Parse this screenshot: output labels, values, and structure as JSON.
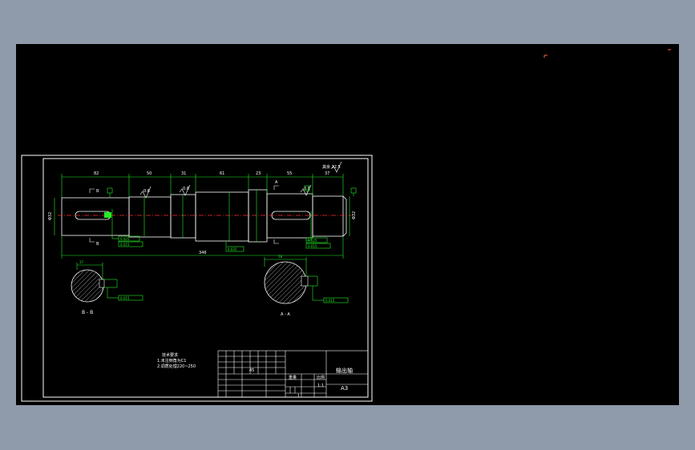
{
  "drawing": {
    "colors": {
      "background": "#000000",
      "outline": "#ffffff",
      "dimension": "#22ee22",
      "centerline": "#ff2a2a",
      "hatch": "#cfcfcf",
      "marker": "#ff6a3a"
    },
    "dims": {
      "top": [
        "82",
        "50",
        "31",
        "61",
        "23",
        "55",
        "37"
      ],
      "total": "346",
      "dia_left": "Φ32",
      "dia_right": "Φ32"
    },
    "tolerances": {
      "t1": "0.025",
      "t2": "0.015",
      "t3": "0.025",
      "t4": "0.015",
      "t5": "0.025",
      "t6": "0.015"
    },
    "roughness": {
      "r1": "0.8",
      "r2": "0.8",
      "r3": "0.8",
      "general": "其余 12.5"
    },
    "datums": {
      "a": "A",
      "b": "B"
    },
    "section_labels": {
      "b": "B - B",
      "a": "A - A",
      "cut_b": "B",
      "cut_a": "A"
    },
    "technical_requirements": {
      "heading": "技术要求",
      "line1": "1.未注倒角为C1",
      "line2": "2.调质处理220~250"
    },
    "title_block": {
      "part_name": "输出轴",
      "sheet_size": "A3",
      "scale": "1:1",
      "material": "45",
      "weight_label": "重量",
      "scale_label": "比例",
      "quantity": "1"
    }
  }
}
